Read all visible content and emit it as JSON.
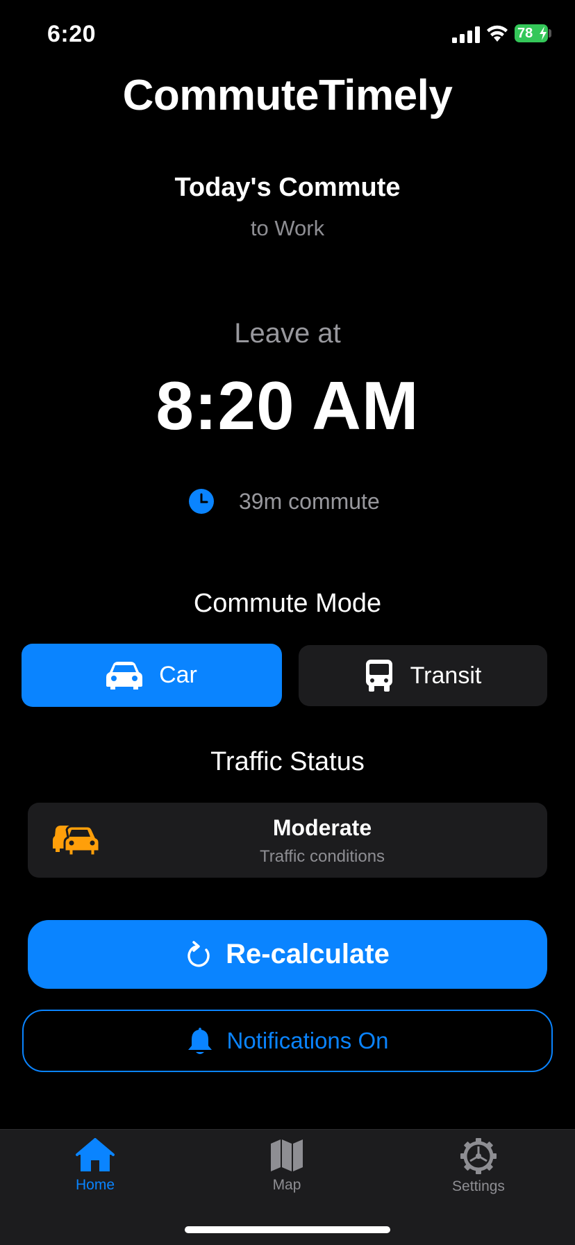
{
  "status_bar": {
    "time": "6:20",
    "battery": "78",
    "icons": [
      "signal-icon",
      "wifi-icon",
      "battery-icon"
    ]
  },
  "app": {
    "title": "CommuteTimely"
  },
  "commute": {
    "title": "Today's Commute",
    "destination": "to Work",
    "leave_label": "Leave at",
    "leave_time": "8:20 AM",
    "duration": "39m commute"
  },
  "mode": {
    "title": "Commute Mode",
    "options": [
      {
        "label": "Car",
        "icon": "car-icon",
        "selected": true
      },
      {
        "label": "Transit",
        "icon": "bus-icon",
        "selected": false
      }
    ]
  },
  "traffic": {
    "title": "Traffic Status",
    "level": "Moderate",
    "description": "Traffic conditions",
    "icon": "cars-icon",
    "color": "#ff9f0a"
  },
  "actions": {
    "recalculate": "Re-calculate",
    "notifications": "Notifications On"
  },
  "tabs": [
    {
      "label": "Home",
      "icon": "home-icon",
      "active": true
    },
    {
      "label": "Map",
      "icon": "map-icon",
      "active": false
    },
    {
      "label": "Settings",
      "icon": "gear-icon",
      "active": false
    }
  ],
  "colors": {
    "accent": "#0a84ff",
    "background": "#000000",
    "card": "#1c1c1e",
    "secondary_text": "#8e8e93",
    "battery": "#34c759",
    "traffic_moderate": "#ff9f0a"
  }
}
